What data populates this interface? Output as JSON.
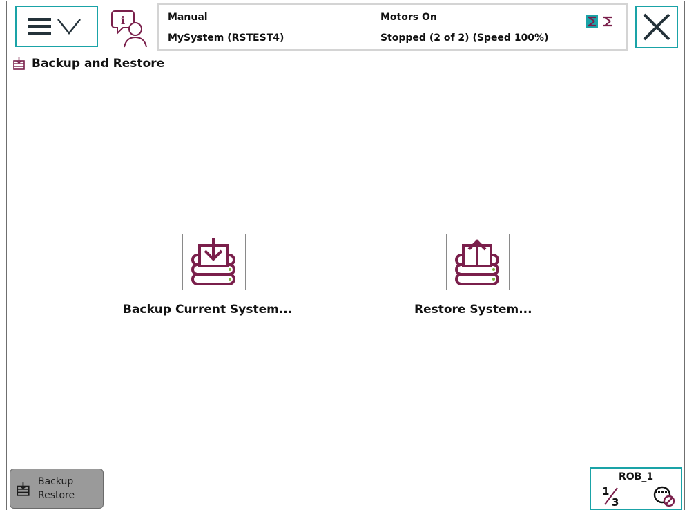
{
  "status": {
    "mode": "Manual",
    "system": "MySystem (RSTEST4)",
    "motors": "Motors On",
    "state": "Stopped (2 of 2) (Speed 100%)"
  },
  "page": {
    "title": "Backup and Restore"
  },
  "actions": {
    "backup_label": "Backup Current System...",
    "restore_label": "Restore System..."
  },
  "taskbar": {
    "line1": "Backup",
    "line2": "Restore"
  },
  "quickset": {
    "unit": "ROB_1",
    "increment": "1/3"
  },
  "icons": {
    "menu": "hamburger-chevron-icon",
    "info": "event-info-icon",
    "mechunits": "mechanical-units-icon",
    "close": "close-icon",
    "backup": "backup-download-icon",
    "restore": "restore-upload-icon",
    "coordinate": "coordinate-system-icon"
  },
  "colors": {
    "accent": "#1aa3a7",
    "brand": "#7a1f4b",
    "text": "#111111",
    "task_bg": "#9a9a9a"
  }
}
